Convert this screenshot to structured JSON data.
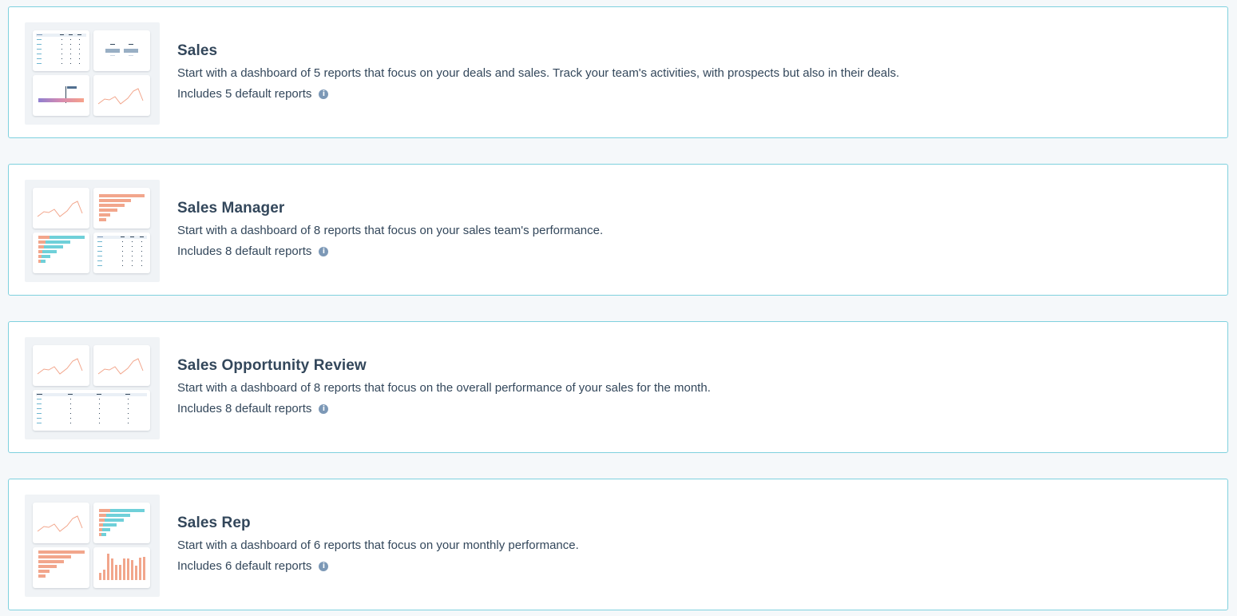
{
  "templates": [
    {
      "title": "Sales",
      "description": "Start with a dashboard of 5 reports that focus on your deals and sales. Track your team's activities, with prospects but also in their deals.",
      "includes": "Includes 5 default reports",
      "info_icon": "info-icon",
      "preview": [
        "table",
        "boxes",
        "heat",
        "line"
      ]
    },
    {
      "title": "Sales Manager",
      "description": "Start with a dashboard of 8 reports that focus on your sales team's performance.",
      "includes": "Includes 8 default reports",
      "info_icon": "info-icon",
      "preview": [
        "line",
        "hbar",
        "hbar-split",
        "table"
      ]
    },
    {
      "title": "Sales Opportunity Review",
      "description": "Start with a dashboard of 8 reports that focus on the overall performance of your sales for the month.",
      "includes": "Includes 8 default reports",
      "info_icon": "info-icon",
      "preview": [
        "line",
        "line",
        "wide-table"
      ]
    },
    {
      "title": "Sales Rep",
      "description": "Start with a dashboard of 6 reports that focus on your monthly performance.",
      "includes": "Includes 6 default reports",
      "info_icon": "info-icon",
      "preview": [
        "line",
        "hbar-split",
        "hbar",
        "vbar"
      ]
    }
  ],
  "colors": {
    "border": "#7fd1de",
    "salmon": "#f2a68c",
    "teal": "#6fd0d9",
    "text": "#33475b",
    "info": "#7c98b6"
  }
}
